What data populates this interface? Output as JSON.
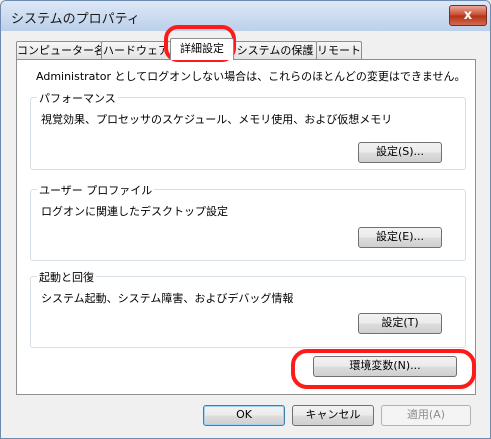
{
  "window": {
    "title": "システムのプロパティ",
    "close_glyph": "x"
  },
  "tabs": [
    {
      "label": "コンピューター名"
    },
    {
      "label": "ハードウェア"
    },
    {
      "label": "詳細設定"
    },
    {
      "label": "システムの保護"
    },
    {
      "label": "リモート"
    }
  ],
  "panel": {
    "admin_note": "Administrator としてログオンしない場合は、これらのほとんどの変更はできません。",
    "performance": {
      "label": "パフォーマンス",
      "description": "視覚効果、プロセッサのスケジュール、メモリ使用、および仮想メモリ",
      "button": "設定(S)..."
    },
    "user_profile": {
      "label": "ユーザー プロファイル",
      "description": "ログオンに関連したデスクトップ設定",
      "button": "設定(E)..."
    },
    "startup": {
      "label": "起動と回復",
      "description": "システム起動、システム障害、およびデバッグ情報",
      "button": "設定(T)"
    },
    "env_button": "環境変数(N)..."
  },
  "footer": {
    "ok": "OK",
    "cancel": "キャンセル",
    "apply": "適用(A)"
  },
  "annotation_color": "#ff1a1a"
}
